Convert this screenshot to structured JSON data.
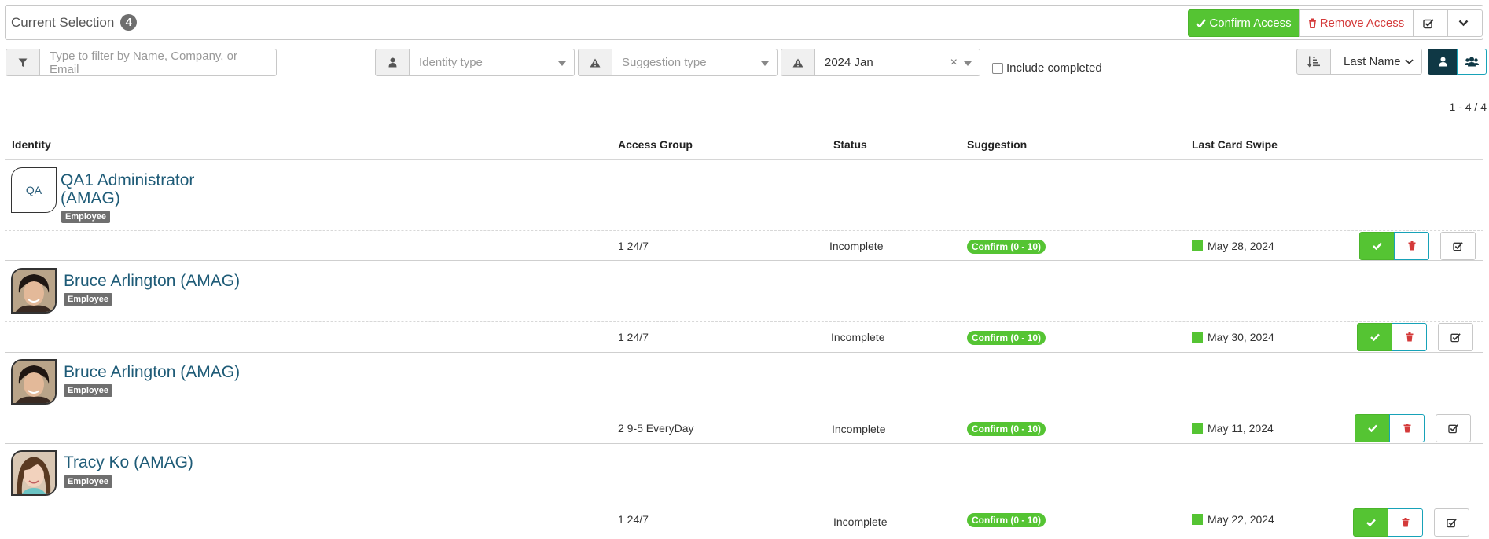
{
  "header": {
    "title": "Current Selection",
    "count": "4",
    "confirm_label": "Confirm Access",
    "remove_label": "Remove Access"
  },
  "filters": {
    "search_placeholder": "Type to filter by Name, Company, or Email",
    "identity_type_placeholder": "Identity type",
    "suggestion_type_placeholder": "Suggestion type",
    "date_value": "2024 Jan",
    "include_completed_label": "Include completed",
    "sort_value": "Last Name"
  },
  "pager": "1 - 4 / 4",
  "columns": {
    "identity": "Identity",
    "access_group": "Access Group",
    "status": "Status",
    "suggestion": "Suggestion",
    "last_swipe": "Last Card Swipe"
  },
  "rows": [
    {
      "name": "QA1 Administrator (AMAG)",
      "initials": "QA",
      "type": "Employee",
      "access_group": "1 24/7",
      "status": "Incomplete",
      "suggestion": "Confirm (0 - 10)",
      "last_swipe": "May 28, 2024"
    },
    {
      "name": "Bruce Arlington (AMAG)",
      "type": "Employee",
      "access_group": "1 24/7",
      "status": "Incomplete",
      "suggestion": "Confirm (0 - 10)",
      "last_swipe": "May 30, 2024"
    },
    {
      "name": "Bruce Arlington (AMAG)",
      "type": "Employee",
      "access_group": "2 9-5 EveryDay",
      "status": "Incomplete",
      "suggestion": "Confirm (0 - 10)",
      "last_swipe": "May 11, 2024"
    },
    {
      "name": "Tracy Ko (AMAG)",
      "type": "Employee",
      "access_group": "1 24/7",
      "status": "Incomplete",
      "suggestion": "Confirm (0 - 10)",
      "last_swipe": "May 22, 2024"
    }
  ],
  "colors": {
    "accent_green": "#55c433",
    "danger_red": "#d43a3a",
    "link_blue": "#1e5b77",
    "dark_teal": "#0f3845"
  }
}
